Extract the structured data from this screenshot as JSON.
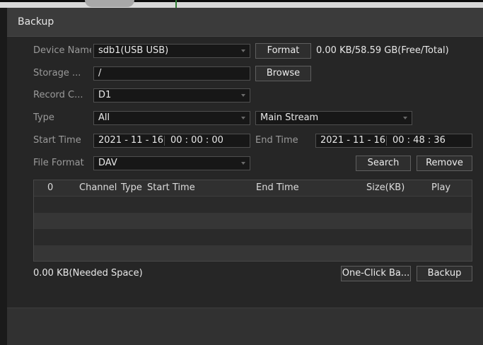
{
  "dialog": {
    "title": "Backup"
  },
  "device_name": {
    "label": "Device Name",
    "value": "sdb1(USB USB)"
  },
  "format_button": {
    "label": "Format"
  },
  "space_info": "0.00 KB/58.59 GB(Free/Total)",
  "storage": {
    "label": "Storage ...",
    "value": "/"
  },
  "browse_button": {
    "label": "Browse"
  },
  "record_channel": {
    "label": "Record C...",
    "value": "D1"
  },
  "type": {
    "label": "Type",
    "value": "All"
  },
  "stream": {
    "value": "Main Stream"
  },
  "start_time": {
    "label": "Start Time",
    "date": "2021 - 11 - 16",
    "time": "00 : 00 : 00"
  },
  "end_time": {
    "label": "End Time",
    "date": "2021 - 11 - 16",
    "time": "00 : 48 : 36"
  },
  "file_format": {
    "label": "File Format",
    "value": "DAV"
  },
  "search_button": {
    "label": "Search"
  },
  "remove_button": {
    "label": "Remove"
  },
  "table": {
    "columns": {
      "index": "0",
      "channel": "Channel",
      "type": "Type",
      "start_time": "Start Time",
      "end_time": "End Time",
      "size": "Size(KB)",
      "play": "Play"
    },
    "rows": []
  },
  "needed_space": "0.00 KB(Needed Space)",
  "one_click_backup_button": {
    "label": "One-Click Ba..."
  },
  "backup_button": {
    "label": "Backup"
  },
  "colors": {
    "background": "#262626",
    "titlebar": "#3b3b3b",
    "field": "#171717",
    "border": "#4f4f4f",
    "text": "#e8e8e8",
    "label": "#9a9a9a"
  }
}
